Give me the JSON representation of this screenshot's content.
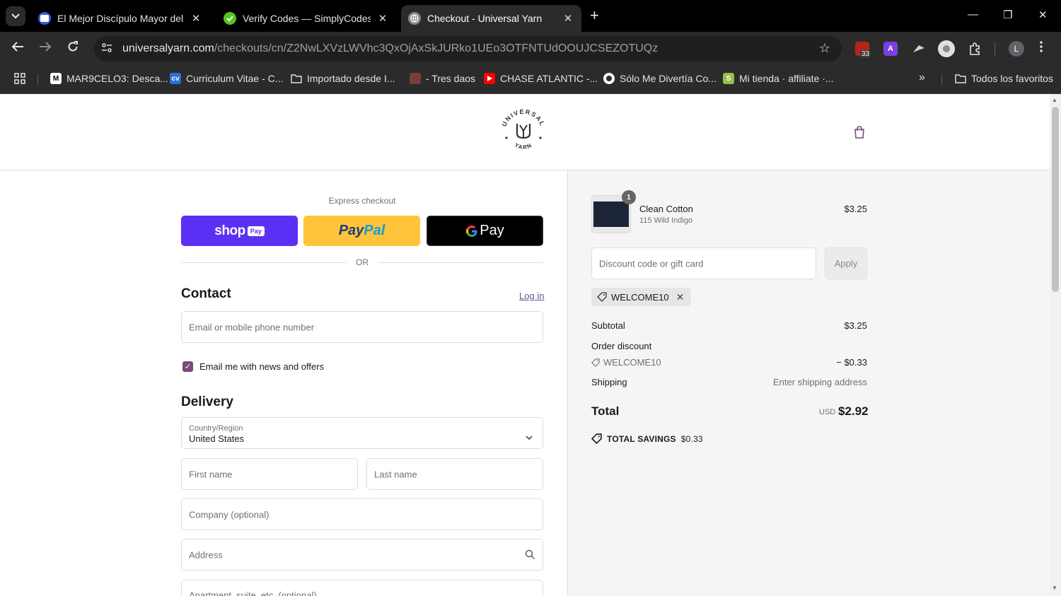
{
  "browser": {
    "tabs": [
      {
        "title": "El Mejor Discípulo Mayor del M",
        "fav_color": "#3b5bdb"
      },
      {
        "title": "Verify Codes — SimplyCodes",
        "fav_color": "#58c322"
      },
      {
        "title": "Checkout - Universal Yarn",
        "fav_color": "#8a8a8a"
      }
    ],
    "url_host": "universalyarn.com",
    "url_path": "/checkouts/cn/Z2NwLXVzLWVhc3QxOjAxSkJURko1UEo3OTFNTUdOOUJCSEZOTUQz",
    "ext_badge": "33",
    "profile_initial": "L",
    "bookmarks": [
      {
        "label": "MAR9CELO3: Desca...",
        "color": "#ffffff"
      },
      {
        "label": "Curriculum Vitae - C...",
        "color": "#2f6fd6"
      },
      {
        "label": "Importado desde I...",
        "color": "folder"
      },
      {
        "label": "- Tres daos",
        "color": "#7a3b3b"
      },
      {
        "label": "CHASE ATLANTIC -...",
        "color": "#ff0000"
      },
      {
        "label": "Sólo Me Divertía Co...",
        "color": "#ffffff"
      },
      {
        "label": "Mi tienda · affiliate ·...",
        "color": "#95bf47"
      }
    ],
    "all_bookmarks": "Todos los favoritos"
  },
  "checkout": {
    "express_label": "Express checkout",
    "shop_pay": "shop",
    "shop_pay_badge": "Pay",
    "paypal_a": "Pay",
    "paypal_b": "Pal",
    "gpay": "Pay",
    "or": "OR",
    "contact": {
      "title": "Contact",
      "login": "Log in",
      "email_placeholder": "Email or mobile phone number",
      "newsletter_label": "Email me with news and offers",
      "newsletter_checked": true
    },
    "delivery": {
      "title": "Delivery",
      "country_label": "Country/Region",
      "country_value": "United States",
      "first_name": "First name",
      "last_name": "Last name",
      "company": "Company (optional)",
      "address": "Address",
      "apartment": "Apartment, suite, etc. (optional)"
    }
  },
  "summary": {
    "item": {
      "qty": "1",
      "name": "Clean Cotton",
      "variant": "115 Wild Indigo",
      "price": "$3.25"
    },
    "discount_placeholder": "Discount code or gift card",
    "apply": "Apply",
    "code": "WELCOME10",
    "subtotal_label": "Subtotal",
    "subtotal": "$3.25",
    "order_discount_label": "Order discount",
    "discount_code": "WELCOME10",
    "discount_amount": "− $0.33",
    "shipping_label": "Shipping",
    "shipping_value": "Enter shipping address",
    "total_label": "Total",
    "currency": "USD",
    "total": "$2.92",
    "savings_label": "TOTAL SAVINGS",
    "savings": "$0.33"
  },
  "logo_text": "UNIVERSAL YARN",
  "colors": {
    "shop_purple": "#5a31f4",
    "paypal_yellow": "#ffc439",
    "checkbox": "#7c4a78"
  }
}
